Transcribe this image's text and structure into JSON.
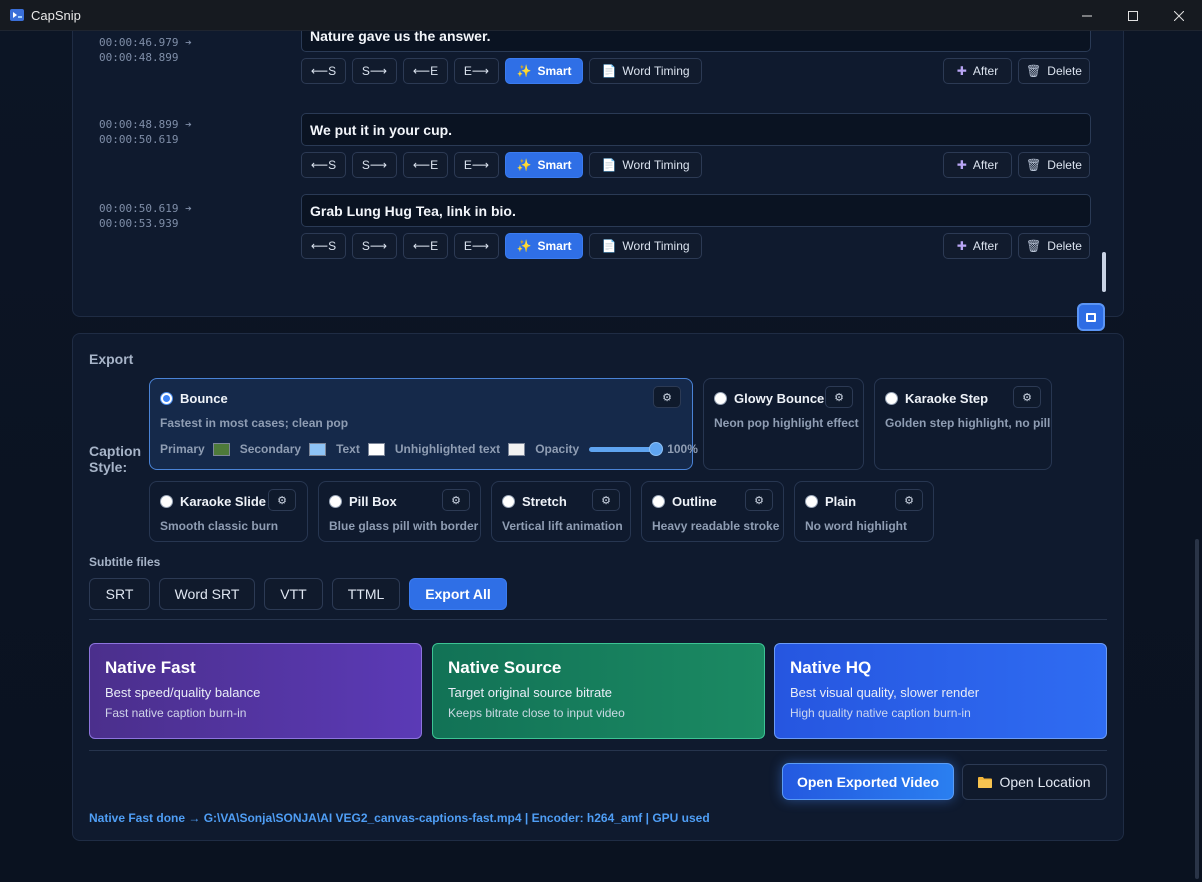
{
  "window": {
    "title": "CapSnip"
  },
  "segments": [
    {
      "start": "00:00:46.979",
      "end": "00:00:48.899",
      "text": "Nature gave us the answer."
    },
    {
      "start": "00:00:48.899",
      "end": "00:00:50.619",
      "text": "We put it in your cup."
    },
    {
      "start": "00:00:50.619",
      "end": "00:00:53.939",
      "text": "Grab Lung Hug Tea, link in bio."
    }
  ],
  "segment_buttons": {
    "shift_start_left": "⟵S",
    "shift_start_right": "S⟶",
    "shift_end_left": "⟵E",
    "shift_end_right": "E⟶",
    "smart": "Smart",
    "word_timing": "Word Timing",
    "after": "After",
    "delete": "Delete"
  },
  "export": {
    "title": "Export",
    "caption_style_label": "Caption Style:",
    "styles": [
      {
        "name": "Bounce",
        "desc": "Fastest in most cases; clean pop",
        "selected": true
      },
      {
        "name": "Glowy Bounce",
        "desc": "Neon pop highlight effect",
        "selected": false
      },
      {
        "name": "Karaoke Step",
        "desc": "Golden step highlight, no pill",
        "selected": false
      },
      {
        "name": "Karaoke Slide",
        "desc": "Smooth classic burn",
        "selected": false
      },
      {
        "name": "Pill Box",
        "desc": "Blue glass pill with border",
        "selected": false
      },
      {
        "name": "Stretch",
        "desc": "Vertical lift animation",
        "selected": false
      },
      {
        "name": "Outline",
        "desc": "Heavy readable stroke",
        "selected": false
      },
      {
        "name": "Plain",
        "desc": "No word highlight",
        "selected": false
      }
    ],
    "colors": {
      "primary_label": "Primary",
      "primary": "#4e7a3a",
      "secondary_label": "Secondary",
      "secondary": "#8ec3f5",
      "text_label": "Text",
      "text": "#ffffff",
      "unhighlighted_label": "Unhighlighted text",
      "unhighlighted": "#f2f2f2",
      "opacity_label": "Opacity",
      "opacity_value": "100%",
      "opacity": 1.0
    },
    "subtitle_files_label": "Subtitle files",
    "subtitle_buttons": [
      "SRT",
      "Word SRT",
      "VTT",
      "TTML",
      "Export All"
    ],
    "presets": [
      {
        "name": "Native Fast",
        "desc": "Best speed/quality balance",
        "sub": "Fast native caption burn-in"
      },
      {
        "name": "Native Source",
        "desc": "Target original source bitrate",
        "sub": "Keeps bitrate close to input video"
      },
      {
        "name": "Native HQ",
        "desc": "Best visual quality, slower render",
        "sub": "High quality native caption burn-in"
      }
    ],
    "open_video": "Open Exported Video",
    "open_location": "Open Location",
    "status": "Native Fast done → G:\\VA\\Sonja\\SONJA\\AI VEG2_canvas-captions-fast.mp4 | Encoder: h264_amf | GPU used"
  }
}
